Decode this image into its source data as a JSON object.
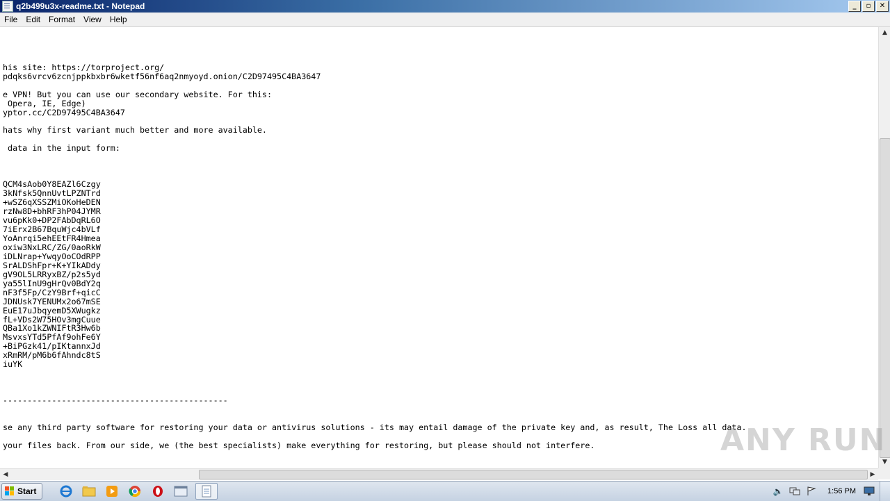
{
  "window": {
    "title": "q2b499u3x-readme.txt - Notepad",
    "buttons": {
      "minimize": "_",
      "maximize": "▫",
      "close": "✕"
    }
  },
  "menu": [
    "File",
    "Edit",
    "Format",
    "View",
    "Help"
  ],
  "document": {
    "text": "\n\n\n\nhis site: https://torproject.org/\npdqks6vrcv6zcnjppkbxbr6wketf56nf6aq2nmyoyd.onion/C2D97495C4BA3647\n\ne VPN! But you can use our secondary website. For this:\n Opera, IE, Edge)\nyptor.cc/C2D97495C4BA3647\n\nhats why first variant much better and more available.\n\n data in the input form:\n\n\n\nQCM4sAob0Y8EAZl6Czgy\n3kNfsk5QnnUvtLPZNTrd\n+wSZ6qXSSZMiOKoHeDEN\nrzNw8D+bhRF3hP04JYMR\nvu6pKk0+DP2FAbDqRL6O\n7iErx2B67BquWjc4bVLf\nYoAnrqi5ehEEtFR4Hmea\noxiw3NxLRC/ZG/0aoRkW\niDLNrap+YwqyOoCOdRPP\nSrALDShFpr+K+YIkADdy\ngV9OL5LRRyxBZ/p2s5yd\nya55lInU9gHrQv0BdY2q\nnF3f5Fp/CzY9Brf+qicC\nJDNUsk7YENUMx2o67mSE\nEuE17uJbqyemD5XWugkz\nfL+VDs2W75HOv3mgCuue\nQBa1Xo1kZWNIFtR3Hw6b\nMsvxsYTd5PfAf9ohFe6Y\n+BiPGzk41/pIKtannxJd\nxRmRM/pM6b6fAhndc8tS\niuYK\n\n\n\n----------------------------------------------\n\n\nse any third party software for restoring your data or antivirus solutions - its may entail damage of the private key and, as result, The Loss all data.\n\nyour files back. From our side, we (the best specialists) make everything for restoring, but please should not interfere."
  },
  "scrollbars": {
    "up": "▲",
    "down": "▼",
    "left": "◀",
    "right": "▶"
  },
  "watermark": "ANY RUN",
  "taskbar": {
    "start_label": "Start",
    "apps": [
      "internet-explorer-icon",
      "explorer-folder-icon",
      "media-player-icon",
      "chrome-icon",
      "opera-icon",
      "window-icon",
      "notepad-icon"
    ],
    "clock": "1:56 PM"
  },
  "colors": {
    "titlebar_start": "#0a246a",
    "titlebar_end": "#a6caf0",
    "watermark": "#8a8a8a"
  }
}
